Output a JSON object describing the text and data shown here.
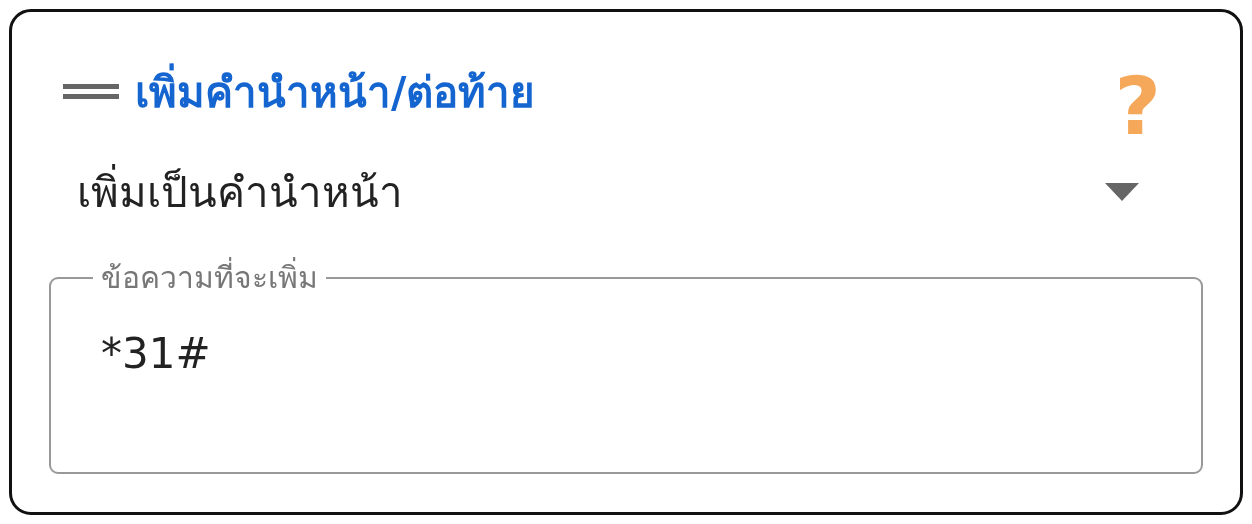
{
  "card": {
    "title": "เพิ่มคำนำหน้า/ต่อท้าย",
    "help": "?"
  },
  "mode_dropdown": {
    "value": "เพิ่มเป็นคำนำหน้า"
  },
  "text_field": {
    "label": "ข้อความที่จะเพิ่ม",
    "value": "*31#"
  }
}
